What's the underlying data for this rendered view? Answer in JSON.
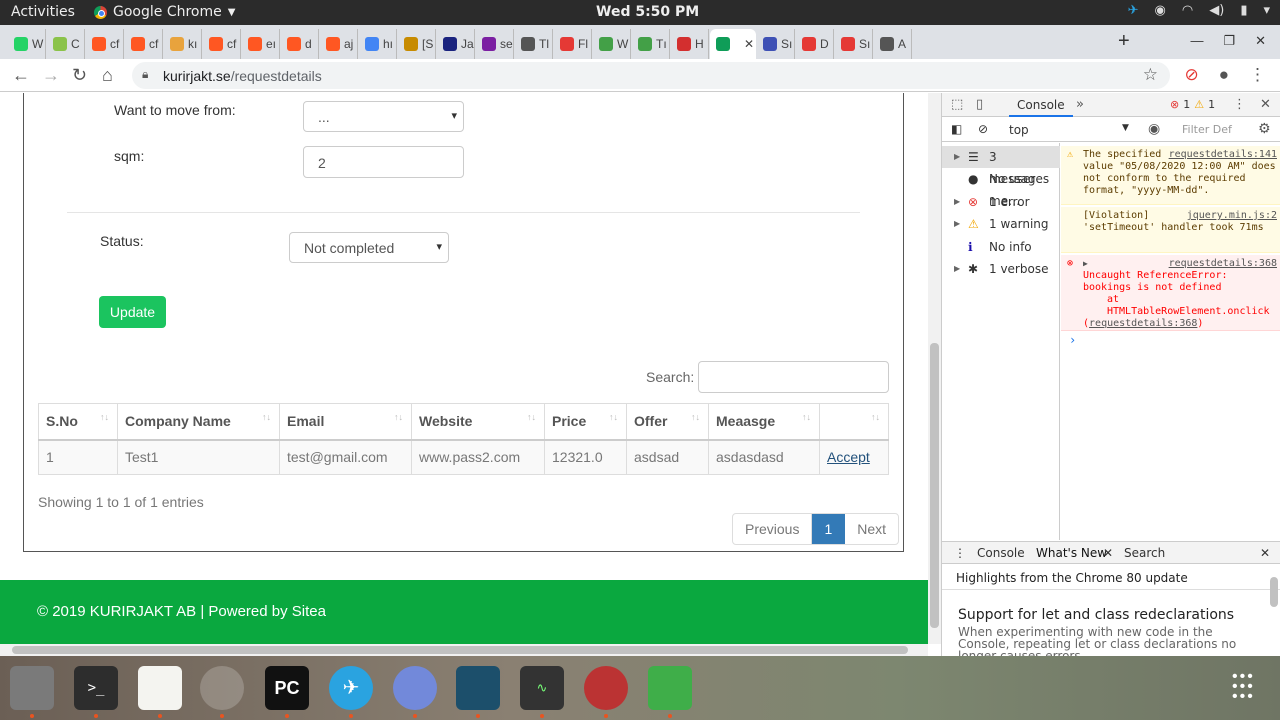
{
  "system": {
    "activities": "Activities",
    "app_name": "Google Chrome",
    "clock": "Wed  5:50 PM"
  },
  "browser": {
    "url_domain": "kurirjakt.se",
    "url_path": "/requestdetails",
    "tabs": [
      {
        "letter": "W",
        "color": "#25d366"
      },
      {
        "letter": "C",
        "color": "#8bc34a"
      },
      {
        "letter": "cf",
        "color": "#ff5722"
      },
      {
        "letter": "cf",
        "color": "#ff5722"
      },
      {
        "letter": "kı",
        "color": "#e8a33d"
      },
      {
        "letter": "cf",
        "color": "#ff5722"
      },
      {
        "letter": "eı",
        "color": "#ff5722"
      },
      {
        "letter": "d",
        "color": "#ff5722"
      },
      {
        "letter": "aj",
        "color": "#ff5722"
      },
      {
        "letter": "hı",
        "color": "#4285f4"
      },
      {
        "letter": "[S",
        "color": "#c78b00"
      },
      {
        "letter": "Ja",
        "color": "#1a237e"
      },
      {
        "letter": "se",
        "color": "#7b1fa2"
      },
      {
        "letter": "Tl",
        "color": "#555555"
      },
      {
        "letter": "Fl",
        "color": "#e53935"
      },
      {
        "letter": "W",
        "color": "#43a047"
      },
      {
        "letter": "Tı",
        "color": "#43a047"
      },
      {
        "letter": "H",
        "color": "#d32f2f"
      },
      {
        "letter": "",
        "color": "#0f9d58"
      },
      {
        "letter": "Sı",
        "color": "#3f51b5"
      },
      {
        "letter": "D",
        "color": "#e53935"
      },
      {
        "letter": "Sı",
        "color": "#e53935"
      },
      {
        "letter": "A",
        "color": "#555555"
      }
    ]
  },
  "form": {
    "move_from_label": "Want to move from:",
    "move_from_value": "...",
    "sqm_label": "sqm:",
    "sqm_value": "2",
    "status_label": "Status:",
    "status_value": "Not completed",
    "update_label": "Update"
  },
  "table": {
    "search_label": "Search:",
    "columns": [
      "S.No",
      "Company Name",
      "Email",
      "Website",
      "Price",
      "Offer",
      "Meaasge",
      ""
    ],
    "rows": [
      [
        "1",
        "Test1",
        "test@gmail.com",
        "www.pass2.com",
        "12321.0",
        "asdsad",
        "asdasdasd",
        "Accept"
      ]
    ],
    "info": "Showing 1 to 1 of 1 entries",
    "pager": {
      "prev": "Previous",
      "current": "1",
      "next": "Next"
    }
  },
  "footer": {
    "text": "© 2019 KURIRJAKT AB | Powered by Sitea"
  },
  "devtools": {
    "tab": "Console",
    "errors": "1",
    "warnings": "1",
    "context": "top",
    "filter": "Filter",
    "levels": "Def",
    "sidebar": [
      {
        "label": "3 messages",
        "icon": "list-icon"
      },
      {
        "label": "No user me…",
        "icon": "user-icon"
      },
      {
        "label": "1 error",
        "icon": "error-icon"
      },
      {
        "label": "1 warning",
        "icon": "warning-icon"
      },
      {
        "label": "No info",
        "icon": "info-icon"
      },
      {
        "label": "1 verbose",
        "icon": "bug-icon"
      }
    ],
    "messages": {
      "warn_src": "requestdetails:141",
      "warn_text": "The specified value \"05/08/2020 12:00 AM\" does not conform to the required format, \"yyyy-MM-dd\".",
      "violation_src": "jquery.min.js:2",
      "violation_text": "[Violation] 'setTimeout' handler took 71ms",
      "error_src": "requestdetails:368",
      "error_text": "Uncaught ReferenceError: bookings is not defined",
      "error_stack1": "at HTMLTableRowElement.onclick",
      "error_stack2": "requestdetails:368"
    },
    "drawer": {
      "tabs": [
        "Console",
        "What's New",
        "Search"
      ],
      "highlights": "Highlights from the Chrome 80 update",
      "feature_title": "Support for let and class redeclarations",
      "feature_desc": "When experimenting with new code in the Console, repeating let or class declarations no longer causes errors."
    }
  }
}
